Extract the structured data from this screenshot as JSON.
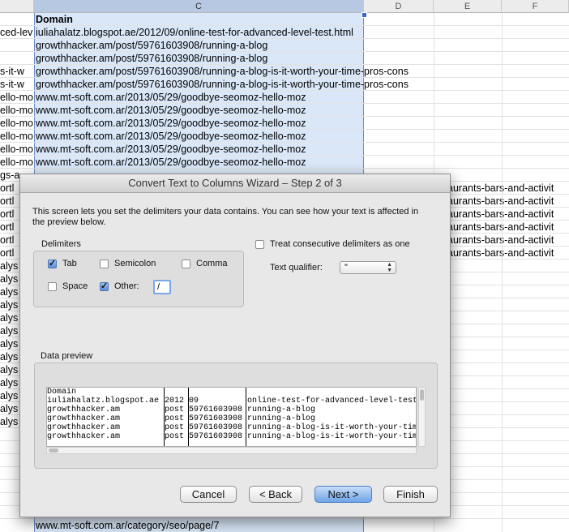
{
  "spreadsheet": {
    "column_headers": [
      "C",
      "D",
      "E",
      "F"
    ],
    "header_cell": "Domain",
    "column_c_rows": [
      "iuliahalatz.blogspot.ae/2012/09/online-test-for-advanced-level-test.html",
      "growthhacker.am/post/59761603908/running-a-blog",
      "growthhacker.am/post/59761603908/running-a-blog",
      "growthhacker.am/post/59761603908/running-a-blog-is-it-worth-your-time-pros-cons",
      "growthhacker.am/post/59761603908/running-a-blog-is-it-worth-your-time-pros-cons",
      "www.mt-soft.com.ar/2013/05/29/goodbye-seomoz-hello-moz",
      "www.mt-soft.com.ar/2013/05/29/goodbye-seomoz-hello-moz",
      "www.mt-soft.com.ar/2013/05/29/goodbye-seomoz-hello-moz",
      "www.mt-soft.com.ar/2013/05/29/goodbye-seomoz-hello-moz",
      "www.mt-soft.com.ar/2013/05/29/goodbye-seomoz-hello-moz",
      "www.mt-soft.com.ar/2013/05/29/goodbye-seomoz-hello-moz"
    ],
    "column_a_fragments": [
      "ced-lev",
      "",
      "",
      "s-it-w",
      "s-it-w",
      "ello-mo",
      "ello-mo",
      "ello-mo",
      "ello-mo",
      "ello-mo",
      "ello-mo",
      "gs-a",
      "ortl",
      "ortl",
      "ortl",
      "ortl",
      "ortl",
      "ortl",
      "alys",
      "alys",
      "alys",
      "alys",
      "alys",
      "alys",
      "alys",
      "alys",
      "alys",
      "alys",
      "alys",
      "alys",
      "alys"
    ],
    "column_e_fragments": [
      "aurants-bars-and-activit",
      "aurants-bars-and-activit",
      "aurants-bars-and-activit",
      "aurants-bars-and-activit",
      "aurants-bars-and-activit",
      "aurants-bars-and-activit"
    ],
    "bottom_row": "www.mt-soft.com.ar/category/seo/page/7"
  },
  "dialog": {
    "title": "Convert Text to Columns Wizard – Step 2 of 3",
    "description": "This screen lets you set the delimiters your data contains.  You can see how your text is affected in the preview below.",
    "delimiters_label": "Delimiters",
    "tab_label": "Tab",
    "semicolon_label": "Semicolon",
    "comma_label": "Comma",
    "space_label": "Space",
    "other_label": "Other:",
    "other_value": "/",
    "consecutive_label": "Treat consecutive delimiters as one",
    "text_qualifier_label": "Text qualifier:",
    "text_qualifier_value": "\"",
    "preview_label": "Data preview",
    "preview_columns": [
      [
        "Domain",
        "iuliahalatz.blogspot.ae",
        "growthhacker.am",
        "growthhacker.am",
        "growthhacker.am",
        "growthhacker.am"
      ],
      [
        "",
        "2012",
        "post",
        "post",
        "post",
        "post"
      ],
      [
        "",
        "09",
        "59761603908",
        "59761603908",
        "59761603908",
        "59761603908"
      ],
      [
        "",
        "online-test-for-advanced-level-test",
        "running-a-blog",
        "running-a-blog",
        "running-a-blog-is-it-worth-your-tim",
        "running-a-blog-is-it-worth-your-tim"
      ]
    ],
    "buttons": {
      "cancel": "Cancel",
      "back": "< Back",
      "next": "Next >",
      "finish": "Finish"
    }
  },
  "colors": {
    "selection": "#d9e7f8",
    "default_button": "#6ea5e8"
  }
}
